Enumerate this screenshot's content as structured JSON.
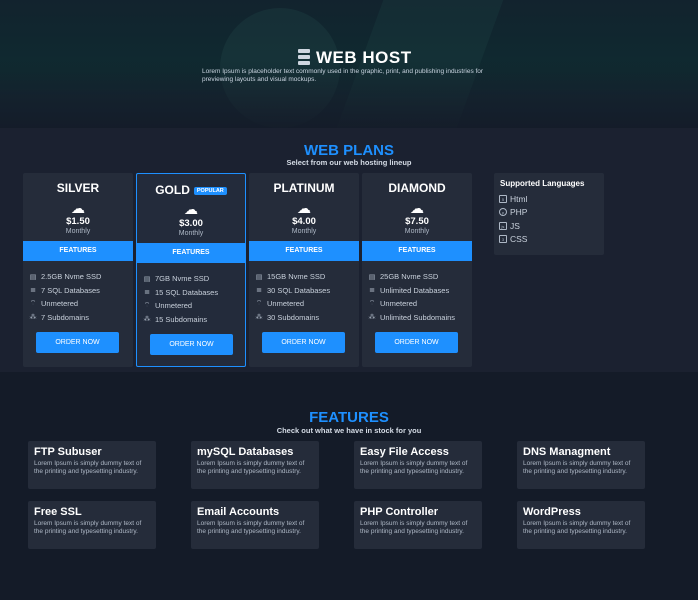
{
  "hero": {
    "title": "WEB HOST",
    "subtitle": "Lorem Ipsum is placeholder text commonly used in the graphic, print, and publishing industries for previewing layouts and visual mockups."
  },
  "plans_section": {
    "title": "WEB PLANS",
    "subtitle": "Select from our web hosting lineup"
  },
  "plans": [
    {
      "name": "SILVER",
      "badge": "",
      "price": "$1.50",
      "period": "Monthly",
      "features_label": "FEATURES",
      "features": [
        "2.5GB Nvme SSD",
        "7 SQL Databases",
        "Unmetered",
        "7 Subdomains"
      ],
      "cta": "ORDER NOW"
    },
    {
      "name": "GOLD",
      "badge": "POPULAR",
      "price": "$3.00",
      "period": "Monthly",
      "features_label": "FEATURES",
      "features": [
        "7GB Nvme SSD",
        "15 SQL Databases",
        "Unmetered",
        "15 Subdomains"
      ],
      "cta": "ORDER NOW"
    },
    {
      "name": "PLATINUM",
      "badge": "",
      "price": "$4.00",
      "period": "Monthly",
      "features_label": "FEATURES",
      "features": [
        "15GB Nvme SSD",
        "30 SQL Databases",
        "Unmetered",
        "30 Subdomains"
      ],
      "cta": "ORDER NOW"
    },
    {
      "name": "DIAMOND",
      "badge": "",
      "price": "$7.50",
      "period": "Monthly",
      "features_label": "FEATURES",
      "features": [
        "25GB Nvme SSD",
        "Unlimited Databases",
        "Unmetered",
        "Unlimited Subdomains"
      ],
      "cta": "ORDER NOW"
    }
  ],
  "feature_icons": [
    "disk-icon",
    "database-icon",
    "wifi-icon",
    "sitemap-icon"
  ],
  "languages": {
    "title": "Supported Languages",
    "items": [
      "Html",
      "PHP",
      "JS",
      "CSS"
    ]
  },
  "features_section": {
    "title": "FEATURES",
    "subtitle": "Check out what we have in stock for you",
    "items": [
      {
        "title": "FTP Subuser",
        "desc": "Lorem Ipsum is simply dummy text of the printing and typesetting industry."
      },
      {
        "title": "mySQL Databases",
        "desc": "Lorem Ipsum is simply dummy text of the printing and typesetting industry."
      },
      {
        "title": "Easy File Access",
        "desc": "Lorem Ipsum is simply dummy text of the printing and typesetting industry."
      },
      {
        "title": "DNS Managment",
        "desc": "Lorem Ipsum is simply dummy text of the printing and typesetting industry."
      },
      {
        "title": "Free SSL",
        "desc": "Lorem Ipsum is simply dummy text of the printing and typesetting industry."
      },
      {
        "title": "Email Accounts",
        "desc": "Lorem Ipsum is simply dummy text of the printing and typesetting industry."
      },
      {
        "title": "PHP Controller",
        "desc": "Lorem Ipsum is simply dummy text of the printing and typesetting industry."
      },
      {
        "title": "WordPress",
        "desc": "Lorem Ipsum is simply dummy text of the printing and typesetting industry."
      }
    ]
  },
  "colors": {
    "accent": "#1e90ff",
    "card": "#252c3a",
    "background": "#141b28"
  }
}
